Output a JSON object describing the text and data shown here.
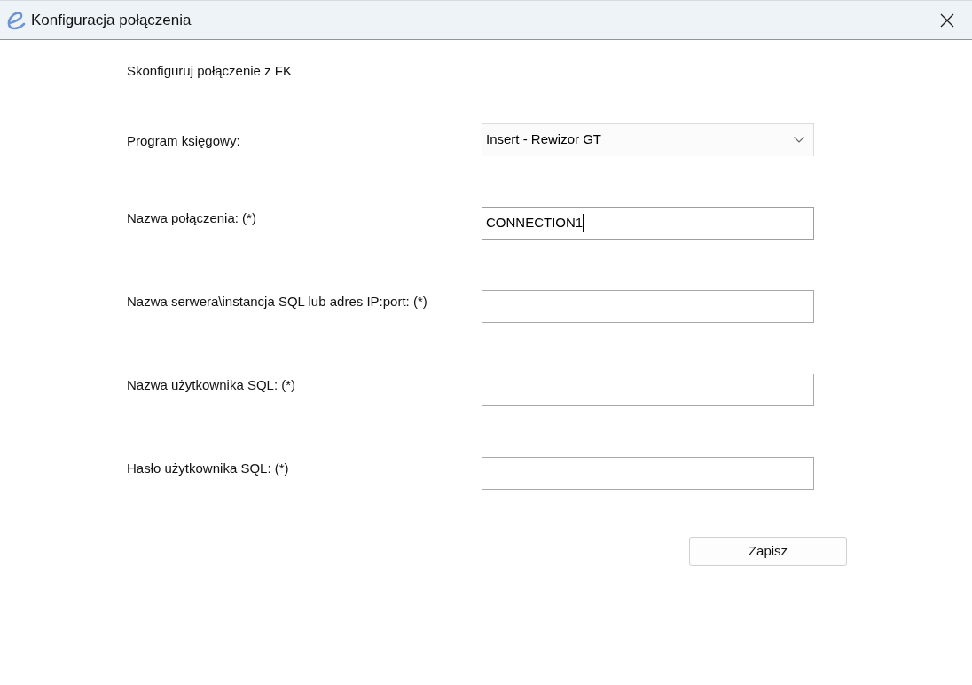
{
  "window": {
    "title": "Konfiguracja połączenia"
  },
  "intro": "Skonfiguruj połączenie z FK",
  "fields": [
    {
      "kind": "select",
      "label": "Program księgowy:",
      "value": "Insert - Rewizor GT",
      "focused": false
    },
    {
      "kind": "text",
      "label": "Nazwa połączenia: (*)",
      "value": "CONNECTION1",
      "focused": true
    },
    {
      "kind": "text",
      "label": "Nazwa serwera\\instancja SQL lub adres IP:port: (*)",
      "focused": false
    },
    {
      "kind": "text",
      "label": "Nazwa użytkownika SQL: (*)",
      "focused": false
    },
    {
      "kind": "text",
      "label": "Hasło użytkownika SQL: (*)",
      "focused": false
    }
  ],
  "buttons": [
    "Zapisz"
  ]
}
